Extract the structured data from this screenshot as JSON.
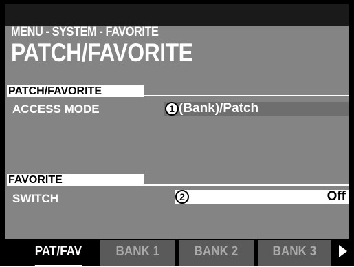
{
  "header": {
    "breadcrumb": "MENU - SYSTEM  - FAVORITE",
    "title": "PATCH/FAVORITE"
  },
  "sections": {
    "patch_favorite": {
      "label": "PATCH/FAVORITE",
      "access_mode": {
        "label": "ACCESS MODE",
        "marker": "1",
        "value": "(Bank)/Patch"
      }
    },
    "favorite": {
      "label": "FAVORITE",
      "switch": {
        "label": "SWITCH",
        "marker": "2",
        "value": "Off"
      }
    }
  },
  "tabs": [
    {
      "label": "PAT/FAV",
      "active": true
    },
    {
      "label": "BANK 1",
      "active": false
    },
    {
      "label": "BANK 2",
      "active": false
    },
    {
      "label": "BANK 3",
      "active": false
    }
  ],
  "icons": {
    "next_page": "right-arrow-icon"
  },
  "colors": {
    "background": "#000000",
    "panel": "#848484",
    "tab_inactive": "#5a5a5a",
    "selected_value": "#ffffff"
  }
}
